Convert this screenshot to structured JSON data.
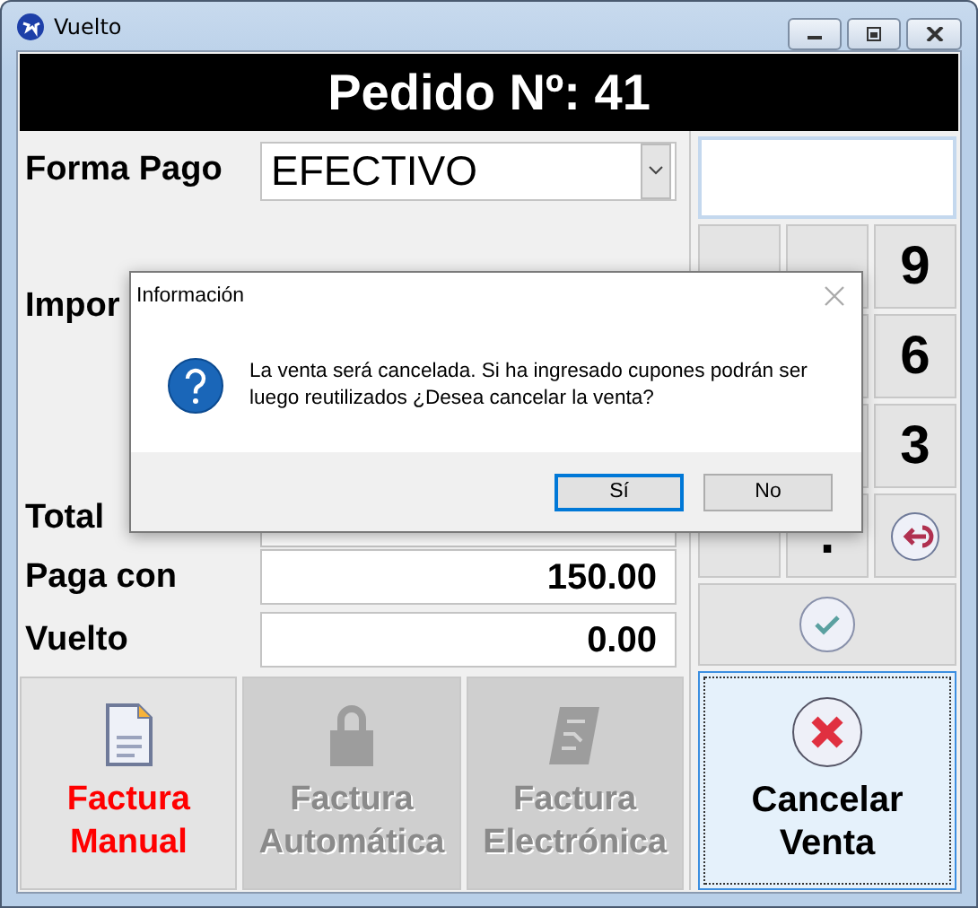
{
  "window": {
    "title": "Vuelto"
  },
  "header": {
    "title": "Pedido Nº: 41"
  },
  "payment": {
    "label": "Forma Pago",
    "value": "EFECTIVO"
  },
  "fields": [
    {
      "label": "Impor",
      "kind": "hidden"
    },
    {
      "label": "Total",
      "kind": "covered"
    },
    {
      "label": "Paga con",
      "kind": "value",
      "value": "150.00"
    },
    {
      "label": "Vuelto",
      "kind": "value",
      "value": "0.00"
    }
  ],
  "keypad": [
    {
      "kind": "blank"
    },
    {
      "kind": "blank"
    },
    {
      "kind": "digit",
      "label": "9"
    },
    {
      "kind": "offset_blank"
    },
    {
      "kind": "digit",
      "label": "6"
    },
    {
      "kind": "offset_blank"
    },
    {
      "kind": "digit",
      "label": "3"
    },
    {
      "kind": "blank"
    },
    {
      "kind": "digit",
      "label": "."
    },
    {
      "kind": "back"
    }
  ],
  "invoice_buttons": [
    {
      "kind": "manual",
      "label": "Factura\nManual",
      "disabled": false
    },
    {
      "kind": "auto",
      "label": "Factura\nAutomática",
      "disabled": true
    },
    {
      "kind": "electronic",
      "label": "Factura\nElectrónica",
      "disabled": true
    }
  ],
  "cancel_button": {
    "label": "Cancelar\nVenta"
  },
  "dialog": {
    "title": "Información",
    "message": "La venta será cancelada. Si ha ingresado cupones podrán ser\nluego reutilizados ¿Desea cancelar la venta?",
    "buttons": [
      {
        "label": "Sí",
        "selected": true
      },
      {
        "label": "No",
        "selected": false
      }
    ]
  }
}
